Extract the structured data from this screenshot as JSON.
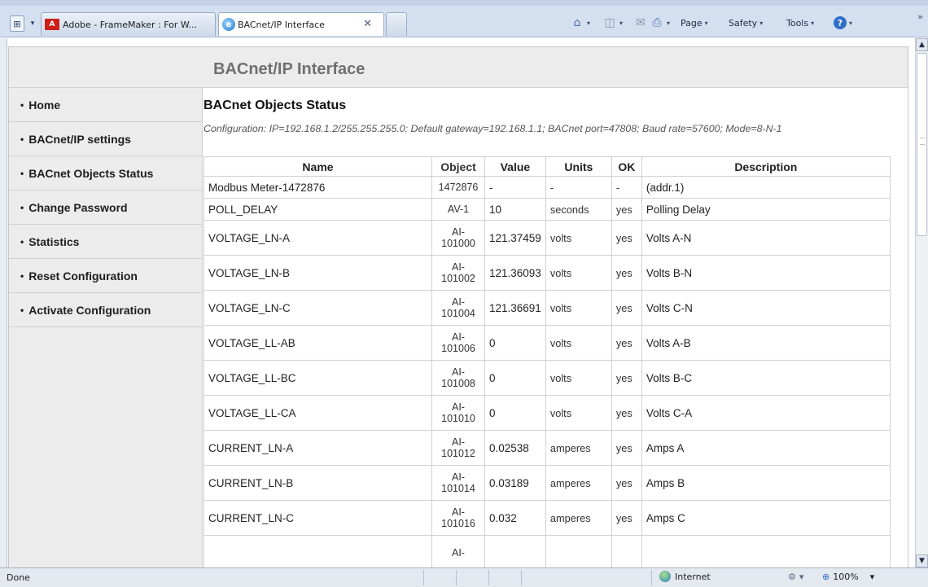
{
  "browser": {
    "tabs": [
      {
        "label": "Adobe - FrameMaker : For W...",
        "icon": "adobe-pdf-icon"
      },
      {
        "label": "BACnet/IP Interface",
        "icon": "ie-page-icon",
        "active": true
      }
    ],
    "tab_close_glyph": "✕",
    "quick_tabs_glyph": "⊞",
    "tab_list_glyph": "▾",
    "icons": {
      "home": "⌂",
      "feeds": "◫",
      "read_mail": "✉",
      "print": "⎙",
      "help": "?"
    },
    "menus": {
      "page": "Page",
      "safety": "Safety",
      "tools": "Tools"
    },
    "caret": "▾",
    "overflow": "»"
  },
  "page": {
    "title": "BACnet/IP Interface",
    "nav": [
      {
        "label": "Home"
      },
      {
        "label": "BACnet/IP settings"
      },
      {
        "label": "BACnet Objects Status"
      },
      {
        "label": "Change Password"
      },
      {
        "label": "Statistics"
      },
      {
        "label": "Reset Configuration"
      },
      {
        "label": "Activate Configuration"
      }
    ],
    "bullet": "•",
    "section_title": "BACnet Objects Status",
    "config_text": "Configuration: IP=192.168.1.2/255.255.255.0; Default gateway=192.168.1.1; BACnet port=47808; Baud rate=57600; Mode=8-N-1",
    "table": {
      "headers": [
        "Name",
        "Object",
        "Value",
        "Units",
        "OK",
        "Description"
      ],
      "rows": [
        {
          "name": "Modbus Meter-1472876",
          "object": "1472876",
          "value": "-",
          "units": "-",
          "ok": "-",
          "description": "(addr.1)"
        },
        {
          "name": "POLL_DELAY",
          "object": "AV-1",
          "value": "10",
          "units": "seconds",
          "ok": "yes",
          "description": "Polling Delay"
        },
        {
          "name": "VOLTAGE_LN-A",
          "object": "AI-\n101000",
          "value": "121.37459",
          "units": "volts",
          "ok": "yes",
          "description": "Volts A-N"
        },
        {
          "name": "VOLTAGE_LN-B",
          "object": "AI-\n101002",
          "value": "121.36093",
          "units": "volts",
          "ok": "yes",
          "description": "Volts B-N"
        },
        {
          "name": "VOLTAGE_LN-C",
          "object": "AI-\n101004",
          "value": "121.36691",
          "units": "volts",
          "ok": "yes",
          "description": "Volts C-N"
        },
        {
          "name": "VOLTAGE_LL-AB",
          "object": "AI-\n101006",
          "value": "0",
          "units": "volts",
          "ok": "yes",
          "description": "Volts A-B"
        },
        {
          "name": "VOLTAGE_LL-BC",
          "object": "AI-\n101008",
          "value": "0",
          "units": "volts",
          "ok": "yes",
          "description": "Volts B-C"
        },
        {
          "name": "VOLTAGE_LL-CA",
          "object": "AI-\n101010",
          "value": "0",
          "units": "volts",
          "ok": "yes",
          "description": "Volts C-A"
        },
        {
          "name": "CURRENT_LN-A",
          "object": "AI-\n101012",
          "value": "0.02538",
          "units": "amperes",
          "ok": "yes",
          "description": "Amps A"
        },
        {
          "name": "CURRENT_LN-B",
          "object": "AI-\n101014",
          "value": "0.03189",
          "units": "amperes",
          "ok": "yes",
          "description": "Amps B"
        },
        {
          "name": "CURRENT_LN-C",
          "object": "AI-\n101016",
          "value": "0.032",
          "units": "amperes",
          "ok": "yes",
          "description": "Amps C"
        },
        {
          "name": "",
          "object": "AI-",
          "value": "",
          "units": "",
          "ok": "",
          "description": ""
        }
      ]
    }
  },
  "statusbar": {
    "status": "Done",
    "zone": "Internet",
    "zoom": "100%",
    "zoom_icon": "⊕",
    "protect_icon": "⚙",
    "caret": "▾"
  },
  "scrollbar": {
    "up": "▲",
    "down": "▼"
  }
}
